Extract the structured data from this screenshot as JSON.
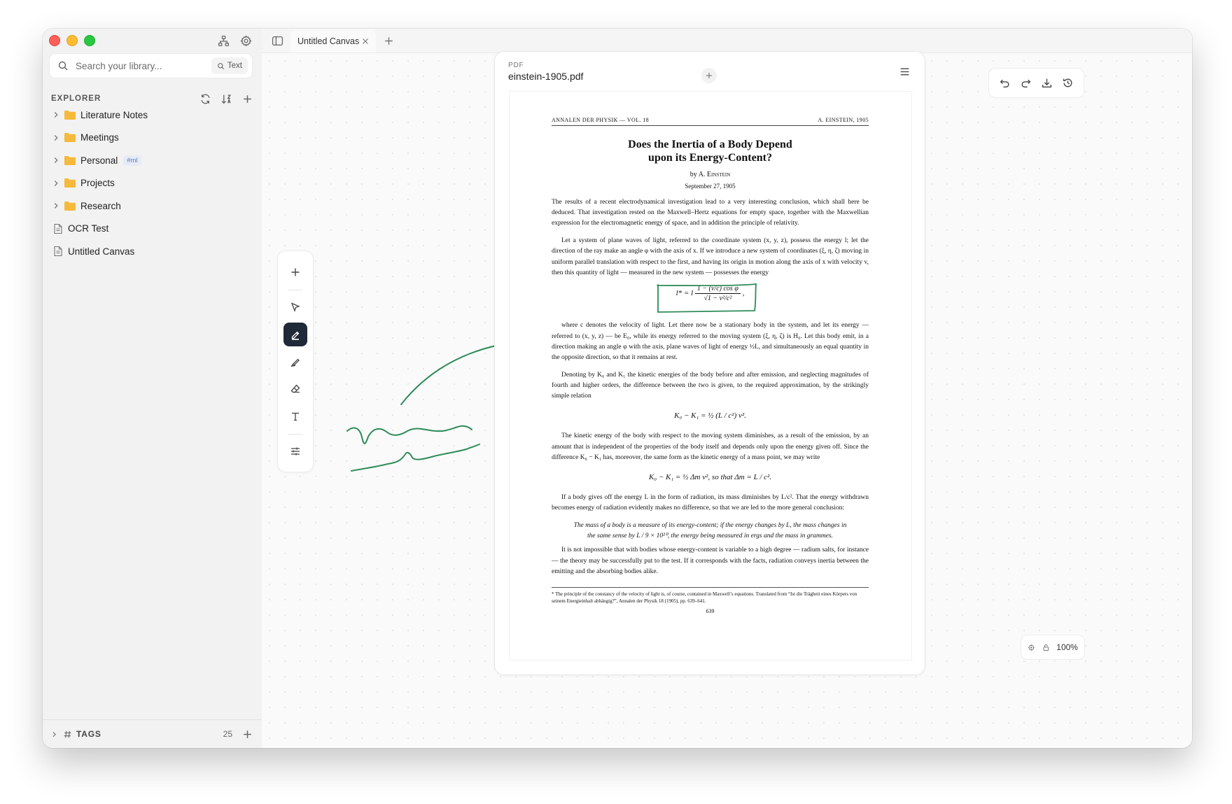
{
  "sidebar": {
    "search_placeholder": "Search your library...",
    "search_mode": "Text",
    "explorer_label": "EXPLORER",
    "items": [
      {
        "label": "Literature Notes",
        "type": "folder",
        "tag": ""
      },
      {
        "label": "Meetings",
        "type": "folder",
        "tag": ""
      },
      {
        "label": "Personal",
        "type": "folder",
        "tag": "#ml"
      },
      {
        "label": "Projects",
        "type": "folder",
        "tag": ""
      },
      {
        "label": "Research",
        "type": "folder",
        "tag": ""
      },
      {
        "label": "OCR Test",
        "type": "file",
        "tag": ""
      },
      {
        "label": "Untitled Canvas",
        "type": "file",
        "tag": ""
      }
    ],
    "tags_label": "TAGS",
    "tags_count": "25"
  },
  "tabs": [
    {
      "label": "Untitled Canvas",
      "active": true
    }
  ],
  "pdf": {
    "kind": "PDF",
    "filename": "einstein-1905.pdf",
    "running_head_left": "ANNALEN DER PHYSIK — VOL. 18",
    "running_head_right": "A. EINSTEIN, 1905",
    "title_line1": "Does the Inertia of a Body Depend",
    "title_line2": "upon its Energy-Content?",
    "byline_prefix": "by A.",
    "byline_name": "Einstein",
    "date": "September 27, 1905",
    "p1": "The results of a recent electrodynamical investigation lead to a very interesting conclusion, which shall here be deduced. That investigation rested on the Maxwell–Hertz equations for empty space, together with the Maxwellian expression for the electromagnetic energy of space, and in addition the principle of relativity.",
    "p2": "Let a system of plane waves of light, referred to the coordinate system (x, y, z), possess the energy l; let the direction of the ray make an angle φ with the axis of x. If we introduce a new system of coordinates (ξ, η, ζ) moving in uniform parallel translation with respect to the first, and having its origin in motion along the axis of x with velocity v, then this quantity of light — measured in the new system — possesses the energy",
    "eq1_lhs": "l* = l",
    "eq1_num": "1 − (v/c) cos φ",
    "eq1_den": "√1 − v²/c²",
    "eq1_tail": ",",
    "p3": "where c denotes the velocity of light. Let there now be a stationary body in the system, and let its energy — referred to (x, y, z) — be E₀, while its energy referred to the moving system (ξ, η, ζ) is H₀. Let this body emit, in a direction making an angle φ with the axis, plane waves of light of energy ½L, and simultaneously an equal quantity in the opposite direction, so that it remains at rest.",
    "p4": "Denoting by K₀ and K₁ the kinetic energies of the body before and after emission, and neglecting magnitudes of fourth and higher orders, the difference between the two is given, to the required approximation, by the strikingly simple relation",
    "eq2": "K₀ − K₁ = ½ (L / c²) v².",
    "p5": "The kinetic energy of the body with respect to the moving system diminishes, as a result of the emission, by an amount that is independent of the properties of the body itself and depends only upon the energy given off. Since the difference K₀ − K₁ has, moreover, the same form as the kinetic energy of a mass point, we may write",
    "eq3": "K₀ − K₁ = ½ Δm v²,   so that   Δm = L / c².",
    "p6": "If a body gives off the energy L in the form of radiation, its mass diminishes by L/c². That the energy withdrawn becomes energy of radiation evidently makes no difference, so that we are led to the more general conclusion:",
    "quote": "The mass of a body is a measure of its energy-content; if the energy changes by L, the mass changes in the same sense by L / 9 × 10²⁰, the energy being measured in ergs and the mass in grammes.",
    "p7": "It is not impossible that with bodies whose energy-content is variable to a high degree — radium salts, for instance — the theory may be successfully put to the test. If it corresponds with the facts, radiation conveys inertia between the emitting and the absorbing bodies alike.",
    "footnote": "* The principle of the constancy of the velocity of light is, of course, contained in Maxwell’s equations. Translated from “Ist die Trägheit eines Körpers von seinem Energieinhalt abhängig?”, Annalen der Physik 18 (1905), pp. 639–641.",
    "page_number": "639"
  },
  "zoom": "100%",
  "colors": {
    "ink": "#2e8b5a",
    "accent_dark": "#1f2937",
    "folder": "#f6b93b"
  }
}
